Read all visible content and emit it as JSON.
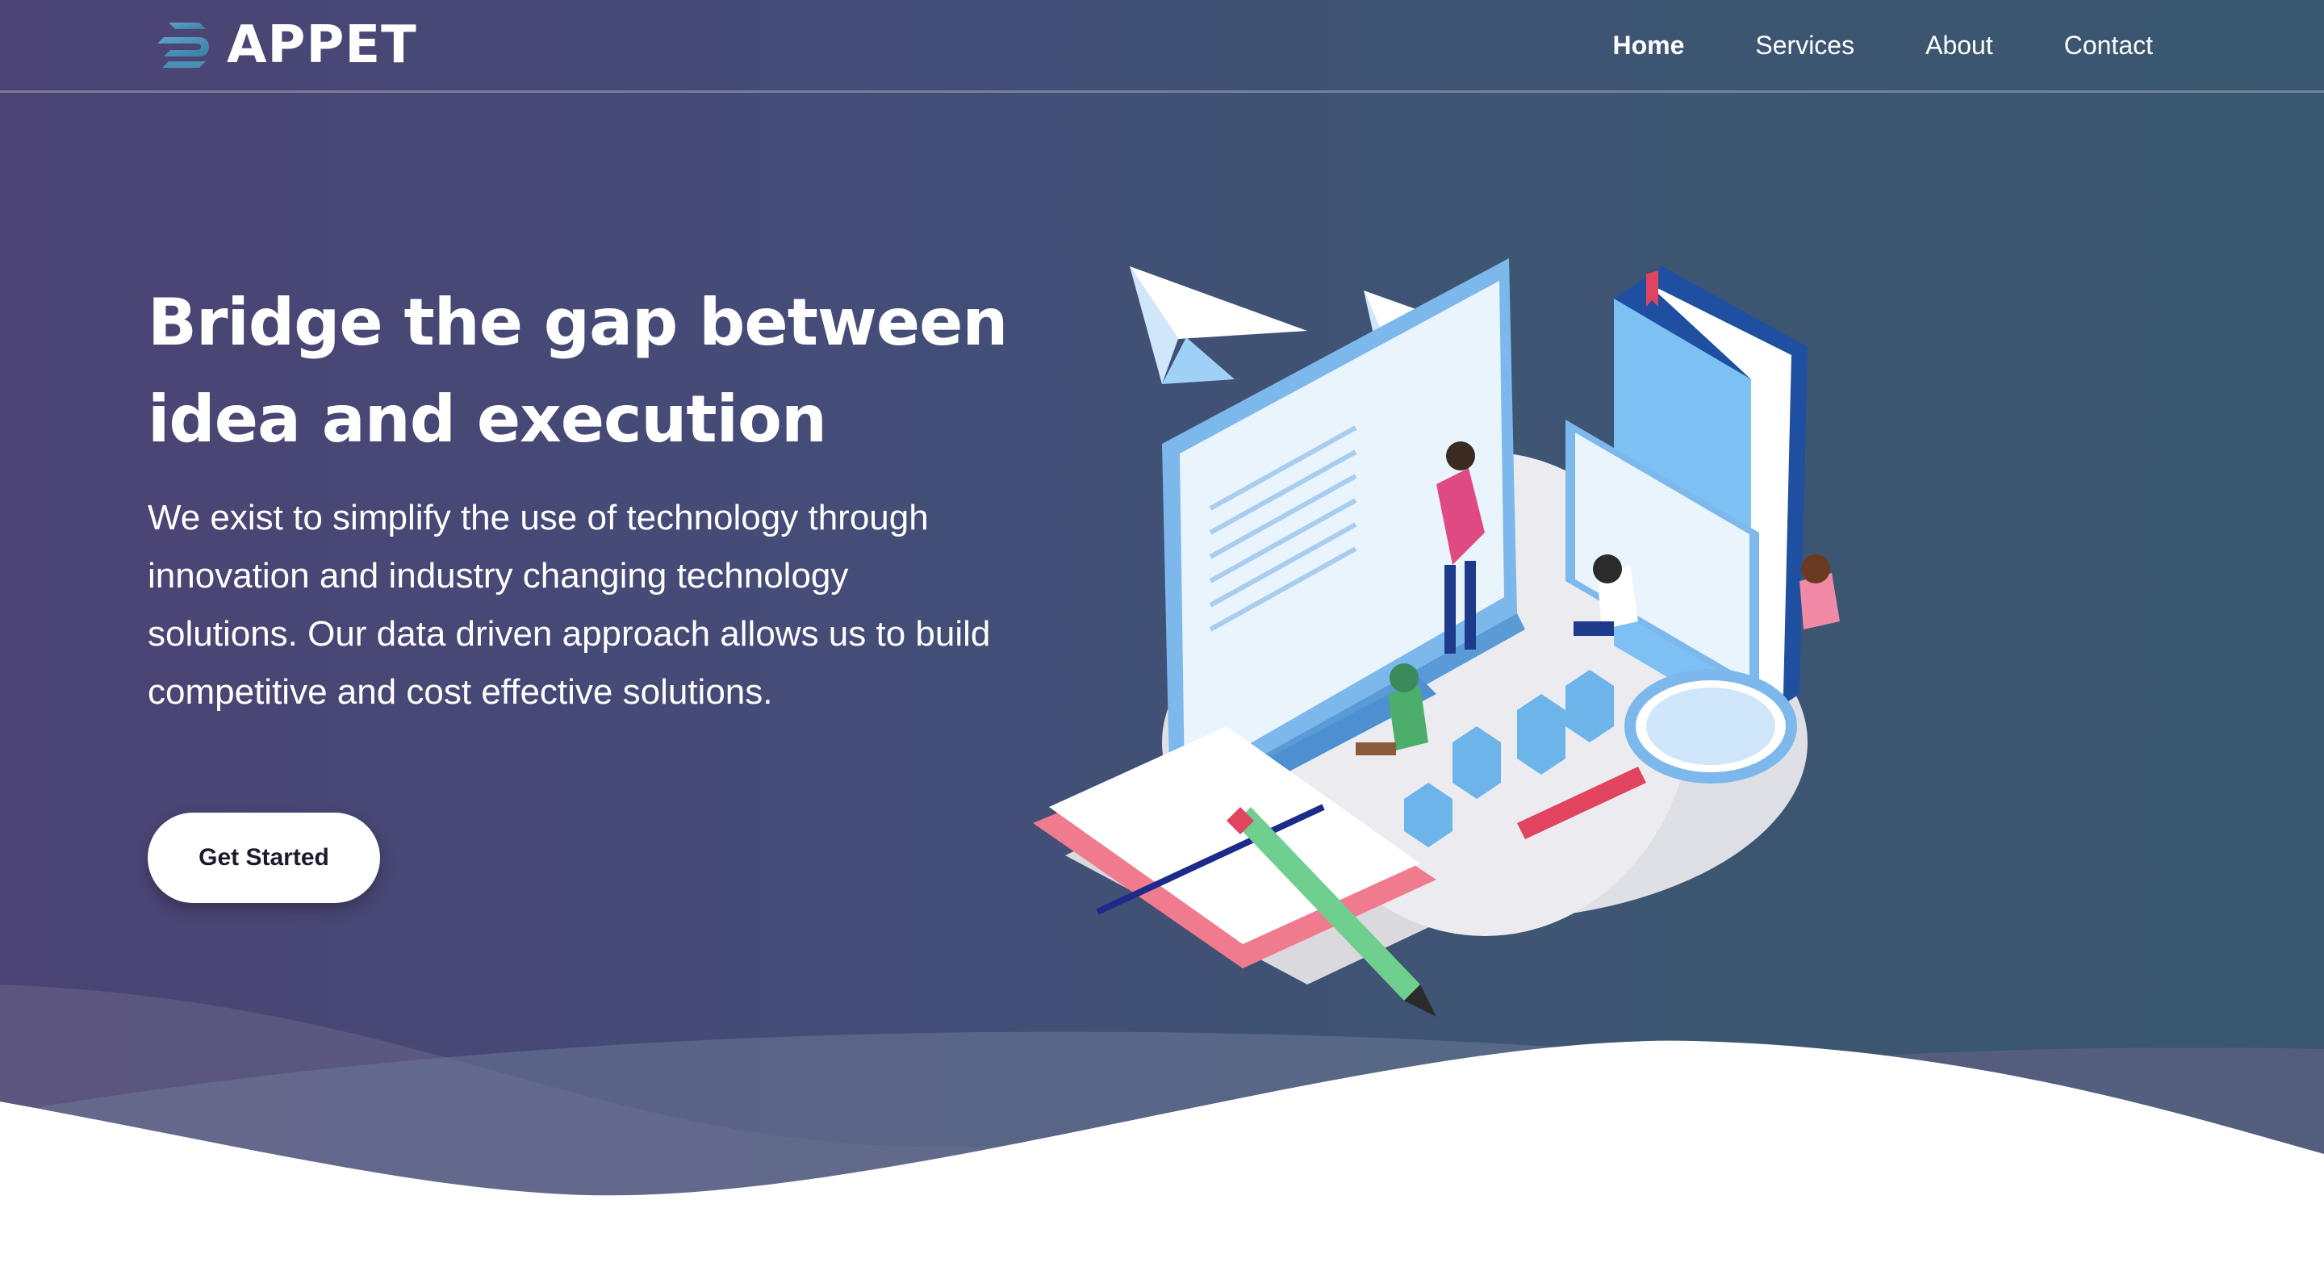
{
  "brand": {
    "name": "APPET",
    "logo_icon": "stacked-layers-logo-icon"
  },
  "nav": {
    "items": [
      {
        "label": "Home",
        "active": true
      },
      {
        "label": "Services",
        "active": false
      },
      {
        "label": "About",
        "active": false
      },
      {
        "label": "Contact",
        "active": false
      }
    ]
  },
  "hero": {
    "headline_line1": "Bridge the gap between",
    "headline_line2": "idea and execution",
    "description": "We exist to simplify the use of technology through innovation and industry changing technology solutions. Our data driven approach allows us to build competitive and cost effective solutions.",
    "cta_label": "Get Started",
    "illustration": "isometric-team-workspace-illustration"
  },
  "colors": {
    "gradient_start": "#4b4373",
    "gradient_end": "#395770",
    "text": "#ffffff",
    "button_bg": "#ffffff",
    "button_text": "#1b1b2e"
  }
}
